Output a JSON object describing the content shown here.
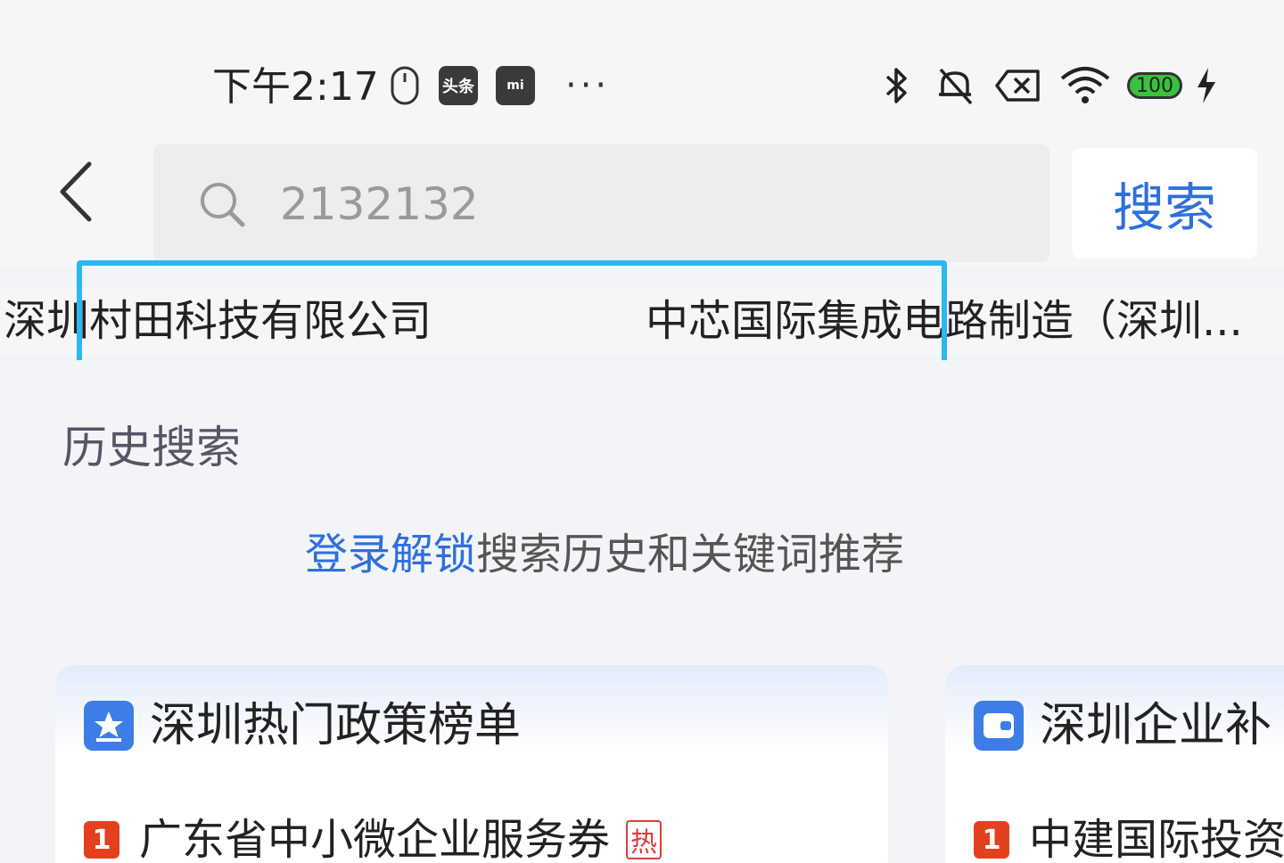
{
  "status_bar": {
    "time": "下午2:17",
    "toutiao_badge": "头条",
    "mi_badge": "mi",
    "more": "···",
    "battery": "100"
  },
  "search": {
    "query": "2132132",
    "button": "搜索",
    "back_icon": "chevron-left-icon",
    "search_icon": "magnifier-icon"
  },
  "suggestions": [
    "深圳村田科技有限公司",
    "中芯国际集成电路制造（深圳..."
  ],
  "history": {
    "title": "历史搜索",
    "login_link": "登录解锁",
    "login_tip": "搜索历史和关键词推荐"
  },
  "cards": [
    {
      "title": "深圳热门政策榜单",
      "icon": "star-badge-icon",
      "items": [
        {
          "rank": "1",
          "text": "广东省中小微企业服务券",
          "tag": "热"
        }
      ]
    },
    {
      "title": "深圳企业补",
      "icon": "wallet-icon",
      "items": [
        {
          "rank": "1",
          "text": "中建国际投资"
        }
      ]
    }
  ],
  "colors": {
    "accent": "#2f6fde",
    "highlight_border": "#2bb7f0",
    "rank_badge": "#e2401e",
    "hot_tag": "#e23b3b"
  }
}
